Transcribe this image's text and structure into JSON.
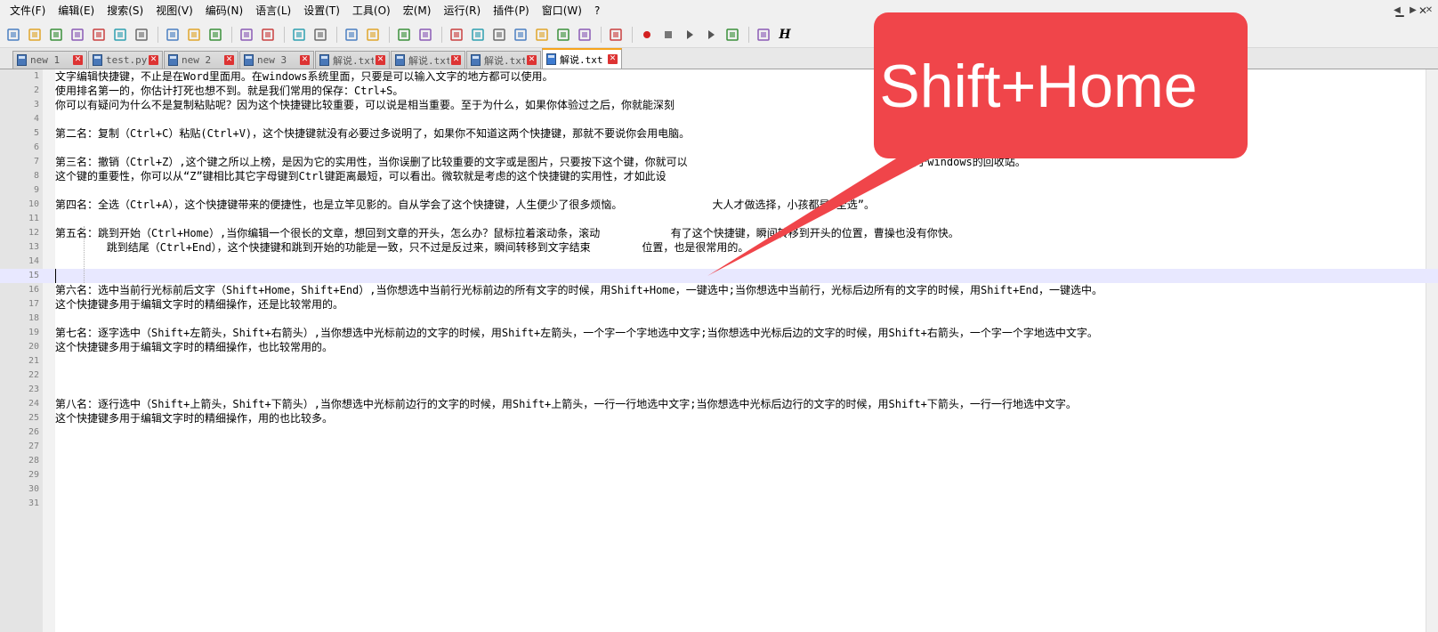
{
  "menu": [
    "文件(F)",
    "编辑(E)",
    "搜索(S)",
    "视图(V)",
    "编码(N)",
    "语言(L)",
    "设置(T)",
    "工具(O)",
    "宏(M)",
    "运行(R)",
    "插件(P)",
    "窗口(W)",
    "?"
  ],
  "toolbar": {
    "icons": [
      "new-file-icon",
      "open-file-icon",
      "save-icon",
      "save-all-icon",
      "close-icon",
      "close-all-icon",
      "print-icon",
      "cut-icon",
      "copy-icon",
      "paste-icon",
      "undo-icon",
      "redo-icon",
      "find-icon",
      "replace-icon",
      "zoom-in-icon",
      "zoom-out-icon",
      "sync-vertical-icon",
      "sync-horizontal-icon",
      "word-wrap-icon",
      "show-all-chars-icon",
      "indent-guide-icon",
      "udl-icon",
      "doc-map-icon",
      "function-list-icon",
      "folder-workspace-icon",
      "monitor-icon",
      "record-macro-icon",
      "stop-record-icon",
      "play-macro-icon",
      "run-macro-multiple-icon",
      "save-macro-icon",
      "hex-icon"
    ],
    "last_label": "H"
  },
  "tabs": [
    {
      "label": "new 1",
      "active": false
    },
    {
      "label": "test.py",
      "active": false
    },
    {
      "label": "new 2",
      "active": false
    },
    {
      "label": "new 3",
      "active": false
    },
    {
      "label": "解说.txt",
      "active": false
    },
    {
      "label": "解说.txt",
      "active": false
    },
    {
      "label": "解说.txt",
      "active": false
    },
    {
      "label": "解说.txt",
      "active": true
    }
  ],
  "lines": [
    "文字编辑快捷键，不止是在Word里面用。在windows系统里面，只要是可以输入文字的地方都可以使用。",
    "使用排名第一的，你估计打死也想不到。就是我们常用的保存：Ctrl+S。",
    "你可以有疑问为什么不是复制粘贴呢？因为这个快捷键比较重要，可以说是相当重要。至于为什么，如果你体验过之后，你就能深刻",
    "",
    "第二名：复制（Ctrl+C）粘贴(Ctrl+V)，这个快捷键就没有必要过多说明了，如果你不知道这两个快捷键，那就不要说你会用电脑。",
    "",
    "第三名：撤销（Ctrl+Z）,这个键之所以上榜，是因为它的实用性，当你误删了比较重要的文字或是图片，只要按下这个键，你就可以                                  当于windows的回收站。",
    "这个键的重要性，你可以从“Z”键相比其它字母键到Ctrl键距离最短，可以看出。微软就是考虑的这个快捷键的实用性，才如此设",
    "",
    "第四名：全选（Ctrl+A），这个快捷键带来的便捷性，也是立竿见影的。自从学会了这个快捷键，人生便少了很多烦恼。              大人才做选择，小孩都是“全选”。",
    "",
    "第五名：跳到开始（Ctrl+Home）,当你编辑一个很长的文章，想回到文章的开头，怎么办？鼠标拉着滚动条，滚动           有了这个快捷键，瞬间转移到开头的位置，曹操也没有你快。",
    "        跳到结尾（Ctrl+End），这个快捷键和跳到开始的功能是一致，只不过是反过来，瞬间转移到文字结束        位置，也是很常用的。",
    "",
    "",
    "第六名：选中当前行光标前后文字（Shift+Home，Shift+End）,当你想选中当前行光标前边的所有文字的时候，用Shift+Home，一键选中;当你想选中当前行，光标后边所有的文字的时候，用Shift+End，一键选中。",
    "这个快捷键多用于编辑文字时的精细操作，还是比较常用的。",
    "",
    "第七名：逐字选中（Shift+左箭头，Shift+右箭头）,当你想选中光标前边的文字的时候，用Shift+左箭头，一个字一个字地选中文字;当你想选中光标后边的文字的时候，用Shift+右箭头，一个字一个字地选中文字。",
    "这个快捷键多用于编辑文字时的精细操作，也比较常用的。",
    "",
    "",
    "",
    "第八名：逐行选中（Shift+上箭头，Shift+下箭头）,当你想选中光标前边行的文字的时候，用Shift+上箭头，一行一行地选中文字;当你想选中光标后边行的文字的时候，用Shift+下箭头，一行一行地选中文字。",
    "这个快捷键多用于编辑文字时的精细操作，用的也比较多。",
    "",
    "",
    "",
    "",
    "",
    ""
  ],
  "line_numbers": [
    "1",
    "2",
    "3",
    "4",
    "5",
    "6",
    "7",
    "8",
    "9",
    "10",
    "11",
    "12",
    "13",
    "14",
    "15",
    "16",
    "17",
    "18",
    "19",
    "20",
    "21",
    "22",
    "23",
    "24",
    "25",
    "26",
    "27",
    "28",
    "29",
    "30",
    "31"
  ],
  "current_line": 15,
  "callout": {
    "text": "Shift+Home",
    "color": "#f0454a"
  },
  "colors": {
    "active_tab_accent": "#f6a41c",
    "current_line_bg": "#e8e8ff",
    "gutter_bg": "#e4e4e4"
  }
}
